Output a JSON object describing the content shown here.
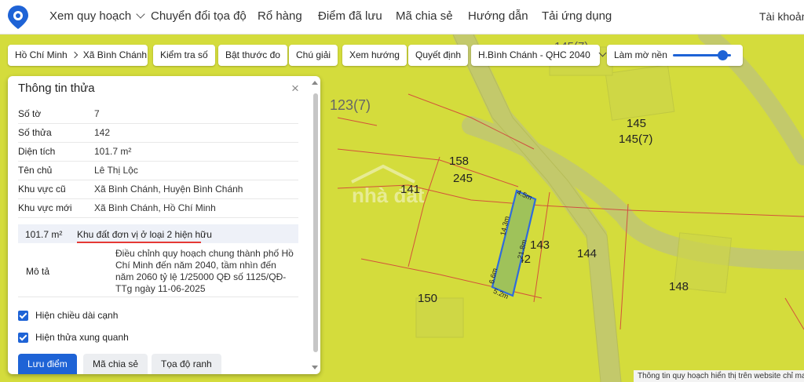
{
  "nav": {
    "items": [
      "Xem quy hoạch",
      "Chuyển đổi tọa độ",
      "Rổ hàng",
      "Điểm đã lưu",
      "Mã chia sẻ",
      "Hướng dẫn",
      "Tải ứng dụng"
    ],
    "account": "Tài khoản"
  },
  "breadcrumb": {
    "province": "Hồ Chí Minh",
    "commune": "Xã Bình Chánh"
  },
  "toolbar": {
    "check_number": "Kiểm tra số",
    "ruler": "Bật thước đo",
    "legend": "Chú giải",
    "direction": "Xem hướng",
    "decision": "Quyết định",
    "plan_select": "H.Bình Chánh - QHC 2040",
    "blur": "Làm mờ nền",
    "blur_level": 0.85
  },
  "panel": {
    "title": "Thông tin thửa",
    "rows": [
      {
        "label": "Số tờ",
        "value": "7"
      },
      {
        "label": "Số thửa",
        "value": "142"
      },
      {
        "label": "Diện tích",
        "value": "101.7 m²"
      },
      {
        "label": "Tên chủ",
        "value": "Lê Thị Lộc"
      },
      {
        "label": "Khu vực cũ",
        "value": "Xã Bình Chánh, Huyện Bình Chánh"
      },
      {
        "label": "Khu vực mới",
        "value": "Xã Bình Chánh, Hồ Chí Minh"
      }
    ],
    "zone": {
      "area": "101.7 m²",
      "name": "Khu đất đơn vị ở loại 2 hiện hữu"
    },
    "description": {
      "label": "Mô tả",
      "text": "Điều chỉnh quy hoạch chung thành phố Hồ Chí Minh đến năm 2040, tầm nhìn đến năm 2060 tỷ lệ 1/25000 QĐ số 1125/QĐ-TTg ngày 11-06-2025"
    },
    "checks": {
      "edge_length": "Hiện chiều dài cạnh",
      "neighbors": "Hiện thửa xung quanh"
    },
    "buttons": {
      "save": "Lưu điểm",
      "share": "Mã chia sẻ",
      "coords": "Tọa độ ranh"
    }
  },
  "map": {
    "labels": [
      "123(7)",
      "145",
      "145(7)",
      "145(7)",
      "158",
      "245",
      "141",
      "143",
      "142",
      "144",
      "148",
      "150"
    ],
    "edges": [
      "4.5m",
      "14.3m",
      "21.8m",
      "6.6m",
      "5.2m"
    ],
    "watermark": "nhà đất"
  },
  "footer": "Thông tin quy hoạch hiển thị trên website chỉ mang tính chất tham khảo",
  "colors": {
    "map_bg": "#d4dc3c",
    "road": "#c3c96b",
    "accent": "#1e63d6",
    "parcel_fill": "#9fc25a",
    "parcel_stroke": "#2f6bdc",
    "lot_line": "#d33a3a"
  },
  "icons": {
    "logo": "map-pin-logo-icon",
    "close": "close-icon",
    "check": "checkbox-checked-icon"
  }
}
